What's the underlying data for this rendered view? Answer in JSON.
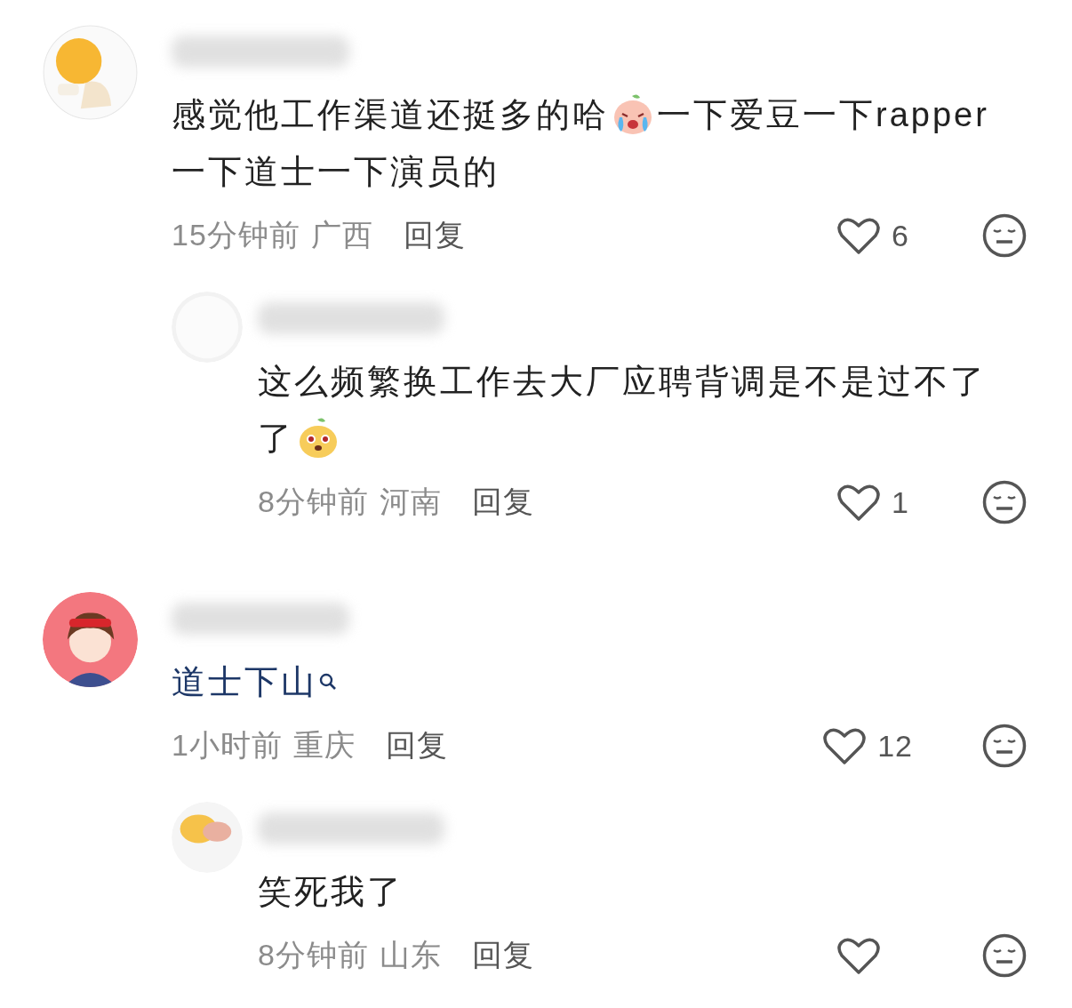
{
  "comments": [
    {
      "avatar": {
        "kind": "picture"
      },
      "content": [
        {
          "kind": "text",
          "text": "感觉他工作渠道还挺多的哈"
        },
        {
          "kind": "emoji"
        },
        {
          "kind": "text",
          "text": "一下爱豆一下rapper"
        },
        {
          "kind": "text",
          "text": "一下道士一下演员的"
        }
      ],
      "time": "15分钟前",
      "location": "广西",
      "reply_label": "回复",
      "likes": "6",
      "replies": [
        {
          "avatar": {
            "kind": "picture"
          },
          "content": [
            {
              "kind": "text",
              "text": "这么频繁换工作去大厂应聘背调是不是过不了"
            },
            {
              "kind": "text",
              "text": "了"
            },
            {
              "kind": "emoji"
            }
          ],
          "time": "8分钟前",
          "location": "河南",
          "reply_label": "回复",
          "likes": "1"
        }
      ]
    },
    {
      "avatar": {
        "kind": "picture"
      },
      "content": [
        {
          "kind": "link",
          "text": "道士下山"
        }
      ],
      "time": "1小时前",
      "location": "重庆",
      "reply_label": "回复",
      "likes": "12",
      "replies": [
        {
          "avatar": {
            "kind": "picture"
          },
          "content": [
            {
              "kind": "text",
              "text": "笑死我了"
            }
          ],
          "time": "8分钟前",
          "location": "山东",
          "reply_label": "回复"
        }
      ]
    }
  ]
}
